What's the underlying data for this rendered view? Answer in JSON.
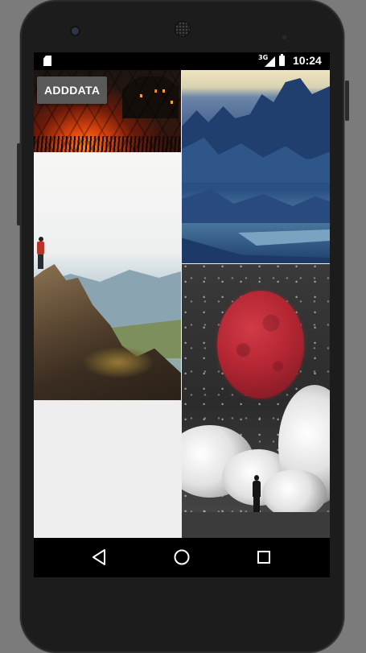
{
  "status_bar": {
    "sd_icon": "sd-card-icon",
    "network_type": "3G",
    "signal_icon": "signal-icon",
    "battery_icon": "battery-icon",
    "time": "10:24"
  },
  "app": {
    "add_button_label": "ADDDATA"
  },
  "gallery": {
    "tiles": [
      {
        "name": "forest-sunset-photo",
        "column": "left"
      },
      {
        "name": "blue-mountains-photo",
        "column": "right"
      },
      {
        "name": "hiker-on-cliff-photo",
        "column": "left"
      },
      {
        "name": "red-moon-clouds-photo",
        "column": "right"
      }
    ]
  },
  "navigation_bar": {
    "back_icon": "back-triangle-icon",
    "home_icon": "home-circle-icon",
    "recents_icon": "recents-square-icon"
  },
  "colors": {
    "status_bar": "#000000",
    "button_bg": "#595959",
    "button_text": "#ffffff",
    "screen_bg": "#eeeeee",
    "device_body": "#1c1c1c"
  }
}
